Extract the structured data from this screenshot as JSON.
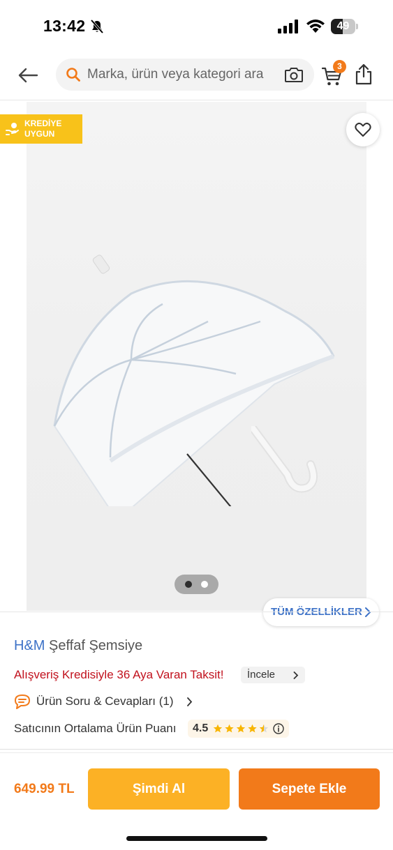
{
  "status_bar": {
    "time": "13:42",
    "battery_level": "49"
  },
  "header": {
    "search_placeholder": "Marka, ürün veya kategori ara",
    "cart_count": "3"
  },
  "gallery": {
    "badge_text": "KREDİYE\nUYGUN",
    "image_count": 2,
    "active_image": 1,
    "all_features_label": "TÜM ÖZELLİKLER"
  },
  "product": {
    "brand": "H&M",
    "name": "Şeffaf Şemsiye",
    "credit_text": "Alışveriş Kredisiyle 36 Aya Varan Taksit!",
    "incele_label": "İncele",
    "qa_label": "Ürün Soru & Cevapları (1)",
    "rating_label": "Satıcının Ortalama Ürün Puanı",
    "rating_value": "4.5"
  },
  "bottom_bar": {
    "price": "649.99 TL",
    "buy_now_label": "Şimdi Al",
    "add_to_cart_label": "Sepete Ekle"
  },
  "colors": {
    "brand_orange": "#f27a1a",
    "buy_now_yellow": "#fcb125",
    "badge_yellow": "#f8c21a",
    "link_blue": "#3d72c7",
    "credit_red": "#c1111d"
  }
}
